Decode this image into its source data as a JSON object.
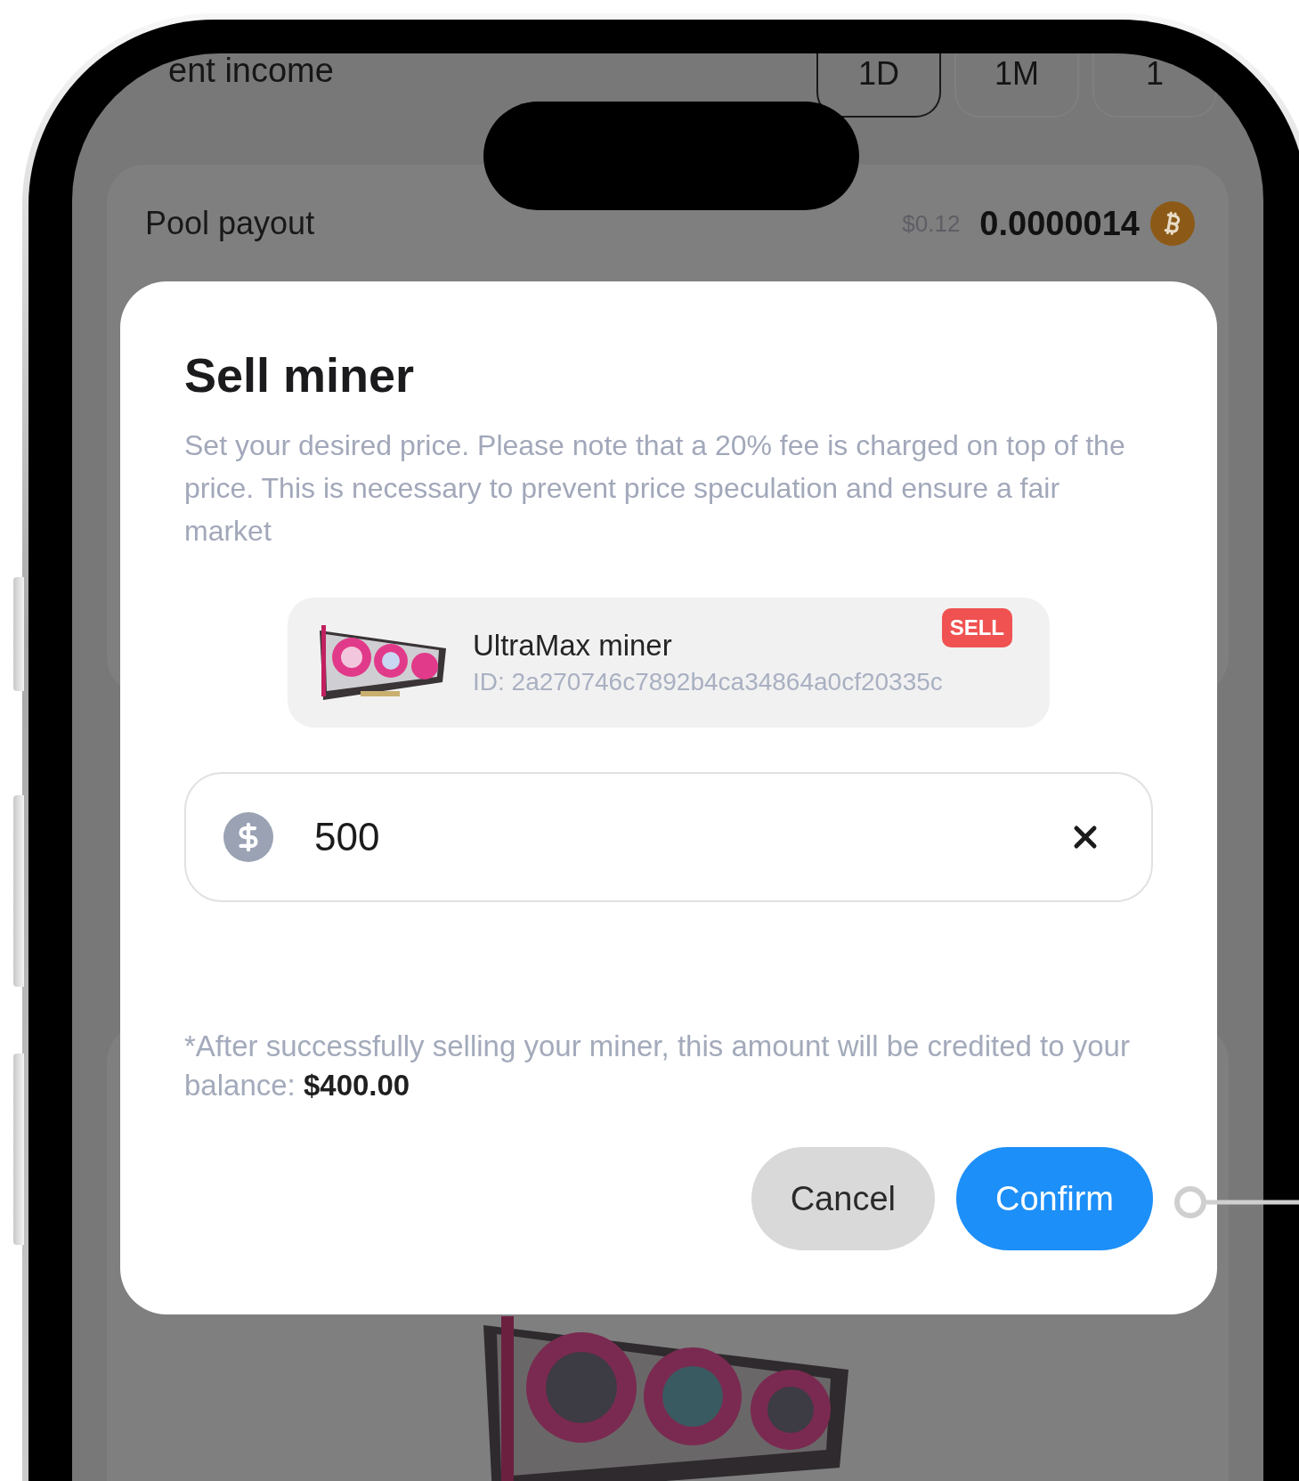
{
  "background": {
    "header": {
      "title": "ent income",
      "tabs": [
        {
          "label": "1D",
          "selected": true
        },
        {
          "label": "1M",
          "selected": false
        },
        {
          "label": "1",
          "selected": false
        }
      ]
    },
    "pool_payout": {
      "label": "Pool payout",
      "usd": "$0.12",
      "amount": "0.0000014"
    }
  },
  "dialog": {
    "title": "Sell miner",
    "description": "Set your desired price. Please note that a 20% fee is charged on top of the price. This is necessary to prevent price speculation and ensure a fair market",
    "item": {
      "name": "UltraMax miner",
      "id": "ID: 2a270746c7892b4ca34864a0cf20335c",
      "badge": "SELL"
    },
    "price_field": {
      "value": "500"
    },
    "note": "*After successfully selling your miner, this amount will be credited to your balance: **$400.00**",
    "buttons": [
      {
        "label": "Cancel",
        "kind": "secondary"
      },
      {
        "label": "Confirm",
        "kind": "primary"
      }
    ]
  }
}
